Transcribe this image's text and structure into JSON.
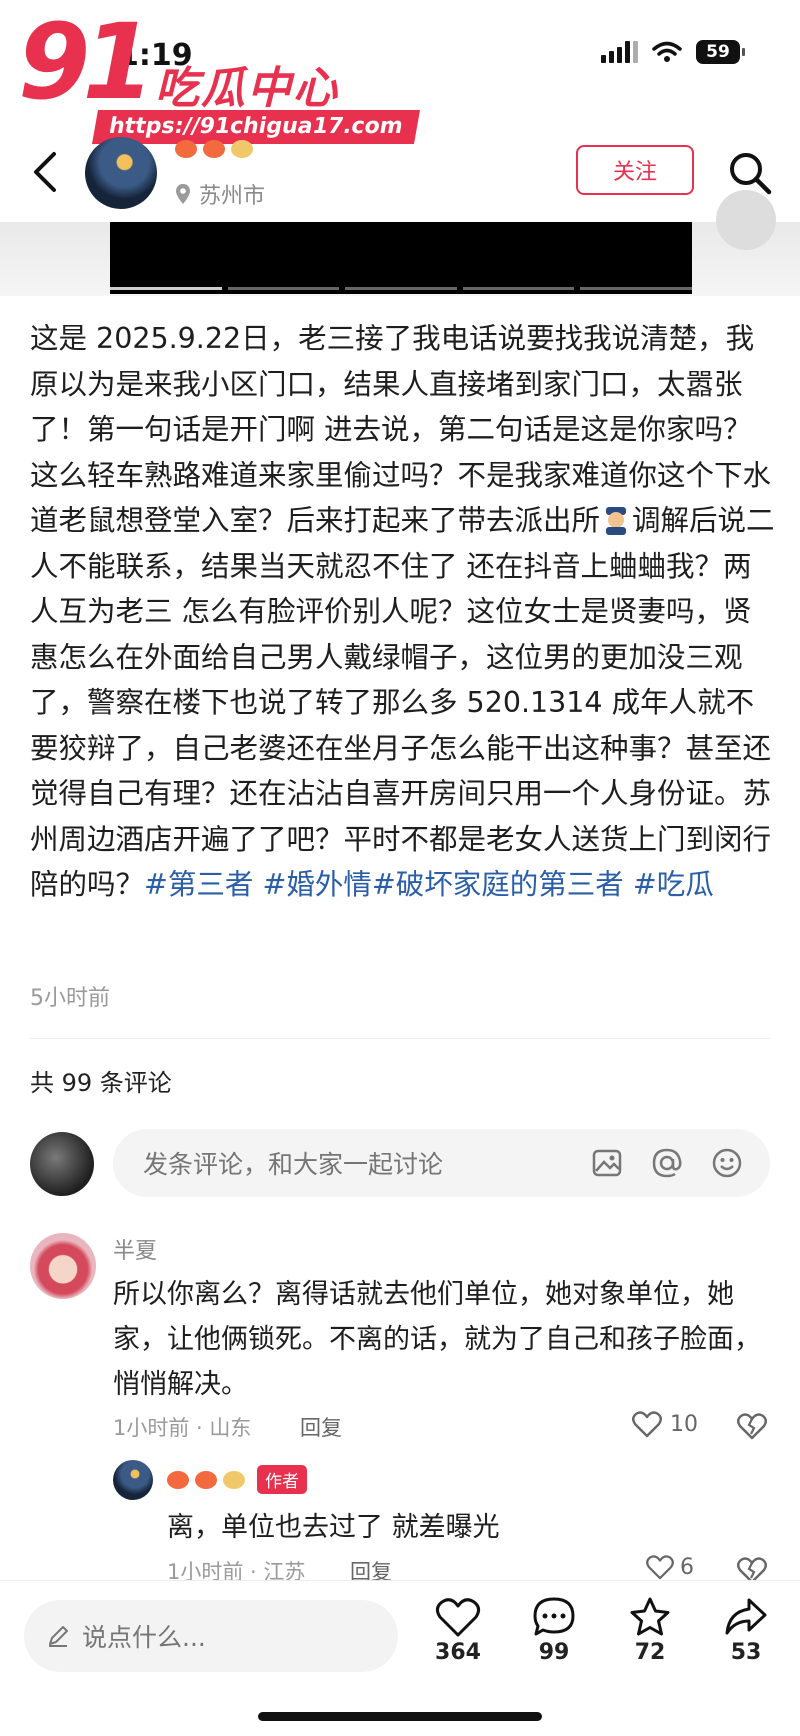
{
  "status_bar": {
    "time": "1:19",
    "battery": "59"
  },
  "watermark": {
    "number": "91",
    "title": "吃瓜中心",
    "url": "https://91chigua17.com"
  },
  "header": {
    "location": "苏州市",
    "follow_label": "关注"
  },
  "post": {
    "text_segments": [
      "这是 2025.9.22日，老三接了我电话说要找我说清楚，我原以为是来我小区门口，结果人直接堵到家门口，太嚣张了！第一句话是开门啊 进去说，第二句话是这是你家吗？这么轻车熟路难道来家里偷过吗？不是我家难道你这个下水道老鼠想登堂入室？后来打起来了带去派出所",
      "调解后说二人不能联系，结果当天就忍不住了 还在抖音上蛐蛐我？两人互为老三 怎么有脸评价别人呢？这位女士是贤妻吗，贤惠怎么在外面给自己男人戴绿帽子，这位男的更加没三观了，警察在楼下也说了转了那么多 520.1314 成年人就不要狡辩了，自己老婆还在坐月子怎么能干出这种事？甚至还觉得自己有理？还在沾沾自喜开房间只用一个人身份证。苏州周边酒店开遍了了吧？平时不都是老女人送货上门到闵行陪的吗？"
    ],
    "tags": [
      "#第三者",
      "#婚外情",
      "#破坏家庭的第三者",
      "#吃瓜"
    ],
    "time": "5小时前"
  },
  "comments_section": {
    "count_label": "共 99 条评论",
    "input_placeholder": "发条评论，和大家一起讨论"
  },
  "comments": [
    {
      "name": "半夏",
      "text": "所以你离么？离得话就去他们单位，她对象单位，她家，让他俩锁死。不离的话，就为了自己和孩子脸面，悄悄解决。",
      "meta": "1小时前 · 山东",
      "reply_label": "回复",
      "likes": "10"
    },
    {
      "author_tag": "作者",
      "text": "离，单位也去过了 就差曝光",
      "meta": "1小时前 · 江苏",
      "reply_label": "回复",
      "likes": "6"
    }
  ],
  "bottom_bar": {
    "say_placeholder": "说点什么...",
    "likes": "364",
    "comments": "99",
    "favorites": "72",
    "shares": "53"
  }
}
